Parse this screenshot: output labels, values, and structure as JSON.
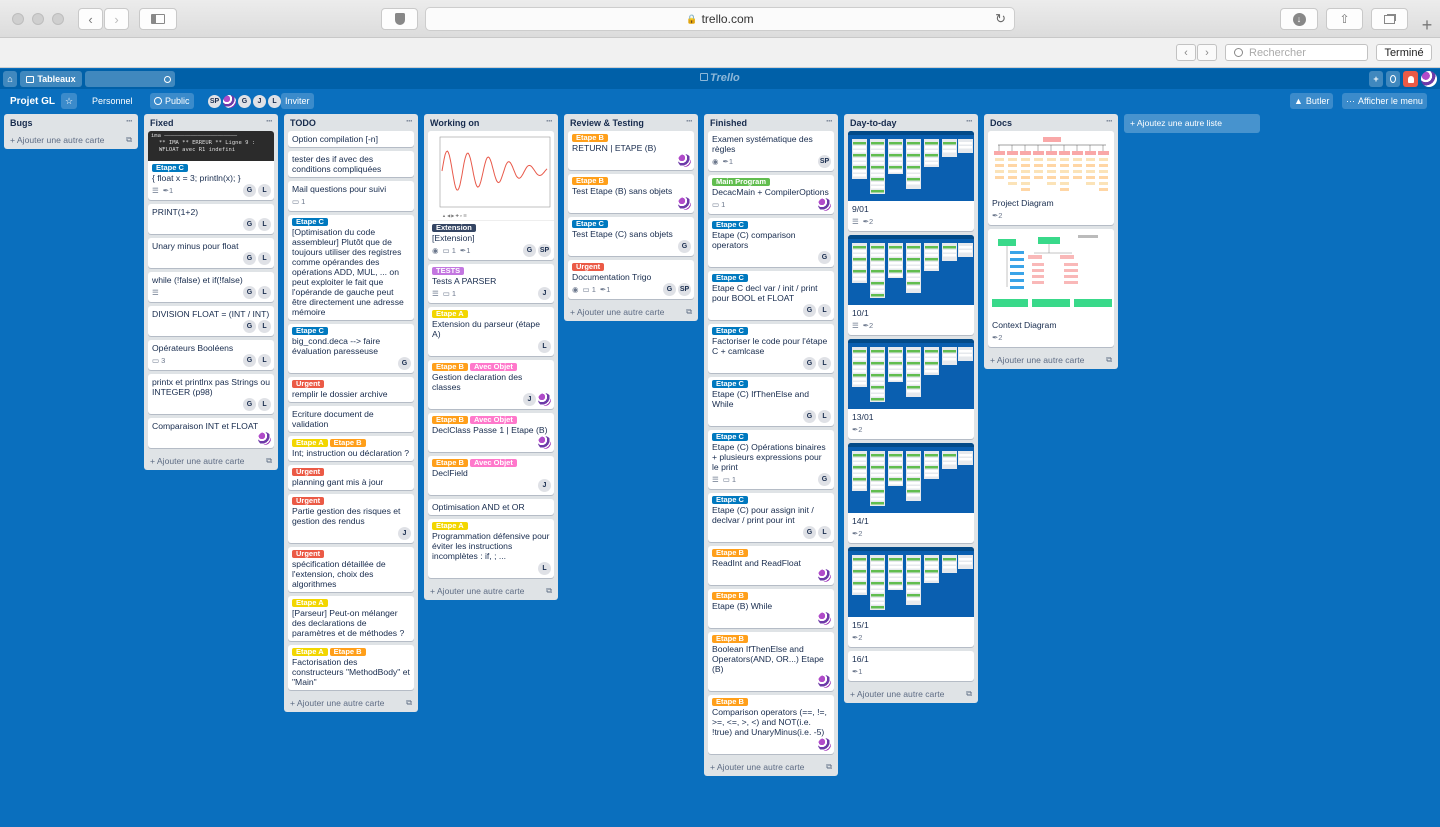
{
  "browser": {
    "url": "trello.com",
    "search_placeholder": "Rechercher",
    "done_label": "Terminé"
  },
  "header": {
    "boards_label": "Tableaux",
    "logo": "Trello"
  },
  "board": {
    "name": "Projet GL",
    "team": "Personnel",
    "visibility": "Public",
    "members": [
      "SP",
      "G",
      "J",
      "L"
    ],
    "invite_label": "Inviter",
    "butler_label": "Butler",
    "menu_label": "Afficher le menu",
    "add_list_label": "+ Ajoutez une autre liste",
    "add_card_label": "+ Ajouter une autre carte"
  },
  "colors": {
    "board_bg": "#0a6fbe",
    "label_blue": "#0079bf",
    "label_orange": "#ff9f1a",
    "label_red": "#eb5a46",
    "label_yellow": "#f2d600",
    "label_pink": "#ff78cb",
    "label_green": "#61bd4f",
    "label_purple": "#c377e0",
    "label_black": "#344563"
  },
  "lists": [
    {
      "title": "Bugs",
      "cards": []
    },
    {
      "title": "Fixed",
      "cards": [
        {
          "terminal": [
            "ima ——————————————————————",
            "** IMA ** ERREUR ** Ligne 9 :",
            "WFLOAT avec R1 indefini"
          ],
          "labels": [
            {
              "text": "Etape C",
              "color": "blue"
            }
          ],
          "title": "{ float x = 3; println(x); }",
          "desc": true,
          "attach": "1",
          "members": [
            "G",
            "L"
          ]
        },
        {
          "title": "PRINT(1+2)",
          "members": [
            "G",
            "L"
          ]
        },
        {
          "title": "Unary minus pour float",
          "members": [
            "G",
            "L"
          ]
        },
        {
          "title": "while (!false) et if(!false)",
          "desc": true,
          "members": [
            "G",
            "L"
          ]
        },
        {
          "title": "DIVISION FLOAT = (INT / INT)",
          "members": [
            "G",
            "L"
          ]
        },
        {
          "title": "Opérateurs Booléens",
          "comments": "3",
          "members": [
            "G",
            "L"
          ]
        },
        {
          "title": "printx et printlnx pas Strings ou INTEGER (p98)",
          "members": [
            "G",
            "L"
          ]
        },
        {
          "title": "Comparaison INT et FLOAT",
          "members": [
            "pat"
          ]
        }
      ]
    },
    {
      "title": "TODO",
      "cards": [
        {
          "title": "Option compilation [-n]"
        },
        {
          "title": "tester des if avec des conditions compliquées"
        },
        {
          "title": "Mail questions pour suivi",
          "comments": "1"
        },
        {
          "labels": [
            {
              "text": "Etape C",
              "color": "blue"
            }
          ],
          "title": "[Optimisation du code assembleur] Plutôt que de toujours utiliser des registres comme opérandes des opérations ADD, MUL, ... on peut exploiter le fait que l'opérande de gauche peut être directement une adresse mémoire"
        },
        {
          "labels": [
            {
              "text": "Etape C",
              "color": "blue"
            }
          ],
          "title": "big_cond.deca --> faire évaluation paresseuse",
          "members": [
            "G"
          ]
        },
        {
          "labels": [
            {
              "text": "Urgent",
              "color": "red"
            }
          ],
          "title": "remplir le dossier archive"
        },
        {
          "title": "Ecriture document de validation"
        },
        {
          "labels": [
            {
              "text": "Etape A",
              "color": "yellow"
            },
            {
              "text": "Etape B",
              "color": "orange"
            }
          ],
          "title": "Int; instruction ou déclaration ?"
        },
        {
          "labels": [
            {
              "text": "Urgent",
              "color": "red"
            }
          ],
          "title": "planning gant mis à jour"
        },
        {
          "labels": [
            {
              "text": "Urgent",
              "color": "red"
            }
          ],
          "title": "Partie gestion des risques et gestion des rendus",
          "members": [
            "J"
          ]
        },
        {
          "labels": [
            {
              "text": "Urgent",
              "color": "red"
            }
          ],
          "title": "spécification détaillée de l'extension, choix des algorithmes"
        },
        {
          "labels": [
            {
              "text": "Etape A",
              "color": "yellow"
            }
          ],
          "title": "[Parseur] Peut-on mélanger des declarations de paramètres et de méthodes ?"
        },
        {
          "labels": [
            {
              "text": "Etape A",
              "color": "yellow"
            },
            {
              "text": "Etape B",
              "color": "orange"
            }
          ],
          "title": "Factorisation des constructeurs \"MethodBody\" et \"Main\""
        }
      ]
    },
    {
      "title": "Working on",
      "cards": [
        {
          "plot": true,
          "labels": [
            {
              "text": "Extension",
              "color": "black"
            }
          ],
          "title": "[Extension]",
          "watch": true,
          "comments": "1",
          "attach": "1",
          "members": [
            "G",
            "SP"
          ]
        },
        {
          "labels": [
            {
              "text": "TESTS",
              "color": "purple"
            }
          ],
          "title": "Tests A PARSER",
          "desc": true,
          "comments": "1",
          "members": [
            "J"
          ]
        },
        {
          "labels": [
            {
              "text": "Etape A",
              "color": "yellow"
            }
          ],
          "title": "Extension du parseur (étape A)",
          "members": [
            "L"
          ]
        },
        {
          "labels": [
            {
              "text": "Etape B",
              "color": "orange"
            },
            {
              "text": "Avec Objet",
              "color": "pink"
            }
          ],
          "title": "Gestion declaration des classes",
          "members": [
            "J",
            "pat"
          ]
        },
        {
          "labels": [
            {
              "text": "Etape B",
              "color": "orange"
            },
            {
              "text": "Avec Objet",
              "color": "pink"
            }
          ],
          "title": "DeclClass Passe 1 | Etape (B)",
          "members": [
            "pat"
          ]
        },
        {
          "labels": [
            {
              "text": "Etape B",
              "color": "orange"
            },
            {
              "text": "Avec Objet",
              "color": "pink"
            }
          ],
          "title": "DeclField",
          "members": [
            "J"
          ]
        },
        {
          "title": "Optimisation AND et OR"
        },
        {
          "labels": [
            {
              "text": "Etape A",
              "color": "yellow"
            }
          ],
          "title": "Programmation défensive pour éviter les instructions incomplètes : if, ; ...",
          "members": [
            "L"
          ]
        }
      ]
    },
    {
      "title": "Review & Testing",
      "cards": [
        {
          "labels": [
            {
              "text": "Etape B",
              "color": "orange"
            }
          ],
          "title": "RETURN | ETAPE (B)",
          "members": [
            "pat"
          ]
        },
        {
          "labels": [
            {
              "text": "Etape B",
              "color": "orange"
            }
          ],
          "title": "Test Etape (B) sans objets",
          "members": [
            "pat"
          ]
        },
        {
          "labels": [
            {
              "text": "Etape C",
              "color": "blue"
            }
          ],
          "title": "Test Etape (C) sans objets",
          "members": [
            "G"
          ]
        },
        {
          "labels": [
            {
              "text": "Urgent",
              "color": "red"
            }
          ],
          "title": "Documentation Trigo",
          "watch": true,
          "comments": "1",
          "attach": "1",
          "members": [
            "G",
            "SP"
          ]
        }
      ]
    },
    {
      "title": "Finished",
      "cards": [
        {
          "title": "Examen systématique des règles",
          "watch": true,
          "attach": "1",
          "members": [
            "SP"
          ]
        },
        {
          "labels": [
            {
              "text": "Main Program",
              "color": "green"
            }
          ],
          "title": "DecacMain + CompilerOptions",
          "comments": "1",
          "members": [
            "pat"
          ]
        },
        {
          "labels": [
            {
              "text": "Etape C",
              "color": "blue"
            }
          ],
          "title": "Etape (C) comparison operators",
          "members": [
            "G"
          ]
        },
        {
          "labels": [
            {
              "text": "Etape C",
              "color": "blue"
            }
          ],
          "title": "Etape C decl var / init / print pour BOOL et FLOAT",
          "members": [
            "G",
            "L"
          ]
        },
        {
          "labels": [
            {
              "text": "Etape C",
              "color": "blue"
            }
          ],
          "title": "Factoriser le code pour l'étape C + camlcase",
          "members": [
            "G",
            "L"
          ]
        },
        {
          "labels": [
            {
              "text": "Etape C",
              "color": "blue"
            }
          ],
          "title": "Etape (C) IfThenElse and While",
          "members": [
            "G",
            "L"
          ]
        },
        {
          "labels": [
            {
              "text": "Etape C",
              "color": "blue"
            }
          ],
          "title": "Etape (C) Opérations binaires + plusieurs expressions pour le print",
          "desc": true,
          "comments": "1",
          "members": [
            "G"
          ]
        },
        {
          "labels": [
            {
              "text": "Etape C",
              "color": "blue"
            }
          ],
          "title": "Etape (C) pour assign init / declvar / print pour int",
          "members": [
            "G",
            "L"
          ]
        },
        {
          "labels": [
            {
              "text": "Etape B",
              "color": "orange"
            }
          ],
          "title": "ReadInt and ReadFloat",
          "members": [
            "pat"
          ]
        },
        {
          "labels": [
            {
              "text": "Etape B",
              "color": "orange"
            }
          ],
          "title": "Etape (B) While",
          "members": [
            "pat"
          ]
        },
        {
          "labels": [
            {
              "text": "Etape B",
              "color": "orange"
            }
          ],
          "title": "Boolean IfThenElse and Operators(AND, OR...) Etape (B)",
          "members": [
            "pat"
          ]
        },
        {
          "labels": [
            {
              "text": "Etape B",
              "color": "orange"
            }
          ],
          "title": "Comparison operators (==, !=, >=, <=, >, <) and NOT(i.e. !true) and UnaryMinus(i.e. -5)",
          "members": [
            "pat"
          ]
        }
      ]
    },
    {
      "title": "Day-to-day",
      "cards": [
        {
          "shot": true,
          "title": "9/01",
          "desc": true,
          "attach": "2"
        },
        {
          "shot": true,
          "title": "10/1",
          "desc": true,
          "attach": "2"
        },
        {
          "shot": true,
          "title": "13/01",
          "attach": "2"
        },
        {
          "shot": true,
          "title": "14/1",
          "attach": "2"
        },
        {
          "shot": true,
          "title": "15/1",
          "attach": "2"
        },
        {
          "title": "16/1",
          "attach": "1"
        }
      ]
    },
    {
      "title": "Docs",
      "cards": [
        {
          "diagram": "project",
          "title": "Project Diagram",
          "attach": "2"
        },
        {
          "diagram": "context",
          "title": "Context Diagram",
          "attach": "2"
        }
      ]
    }
  ]
}
